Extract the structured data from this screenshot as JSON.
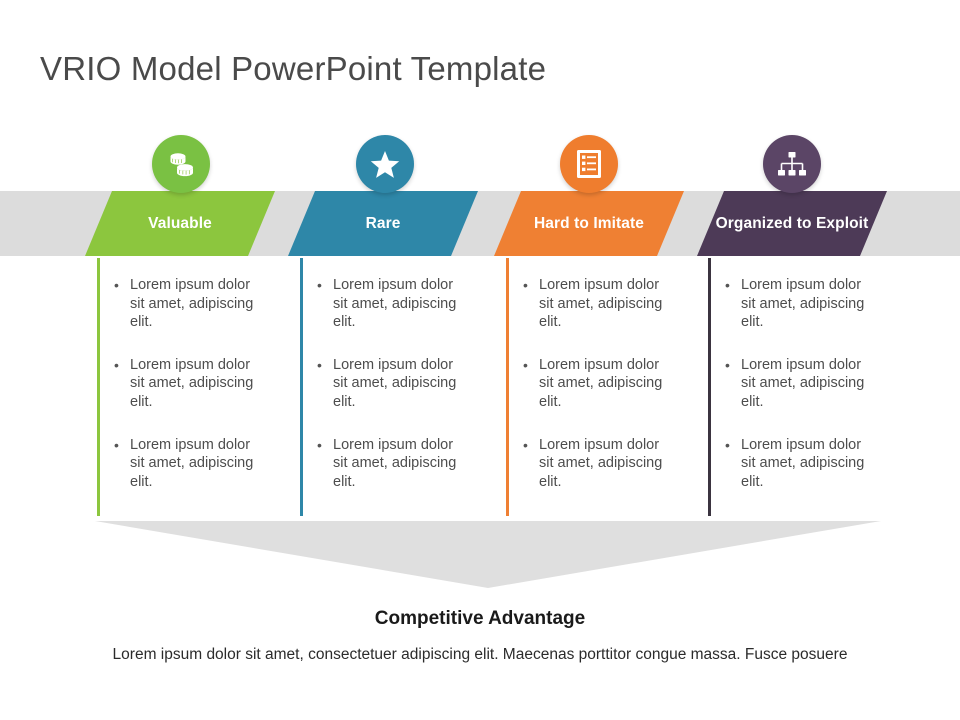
{
  "slide": {
    "title": "VRIO Model PowerPoint Template",
    "accent_gray_band": "#dcdcdc",
    "funnel_color": "#dfdfdf"
  },
  "columns": [
    {
      "label": "Valuable",
      "color": "#8cc63e",
      "icon_color": "#7ac143",
      "icon": "coins-icon",
      "bullets": [
        "Lorem ipsum dolor sit amet, adipiscing elit.",
        "Lorem ipsum dolor sit amet, adipiscing elit.",
        "Lorem ipsum dolor sit amet, adipiscing elit."
      ]
    },
    {
      "label": "Rare",
      "color": "#2e87a8",
      "icon_color": "#2e87a8",
      "icon": "star-icon",
      "bullets": [
        "Lorem ipsum dolor sit amet, adipiscing elit.",
        "Lorem ipsum dolor sit amet, adipiscing elit.",
        "Lorem ipsum dolor sit amet, adipiscing elit."
      ]
    },
    {
      "label": "Hard to Imitate",
      "color": "#ef8033",
      "icon_color": "#ef7d2e",
      "icon": "checklist-icon",
      "bullets": [
        "Lorem ipsum dolor sit amet, adipiscing elit.",
        "Lorem ipsum dolor sit amet, adipiscing elit.",
        "Lorem ipsum dolor sit amet, adipiscing elit."
      ]
    },
    {
      "label": "Organized to Exploit",
      "color": "#4d3a57",
      "icon_color": "#5b4566",
      "icon": "org-chart-icon",
      "bullets": [
        "Lorem ipsum dolor sit amet, adipiscing elit.",
        "Lorem ipsum dolor sit amet, adipiscing elit.",
        "Lorem ipsum dolor sit amet, adipiscing elit."
      ]
    }
  ],
  "footer": {
    "heading": "Competitive Advantage",
    "description": "Lorem ipsum dolor sit amet, consectetuer adipiscing elit. Maecenas porttitor congue massa. Fusce posuere"
  },
  "bullet_glyph": "•"
}
